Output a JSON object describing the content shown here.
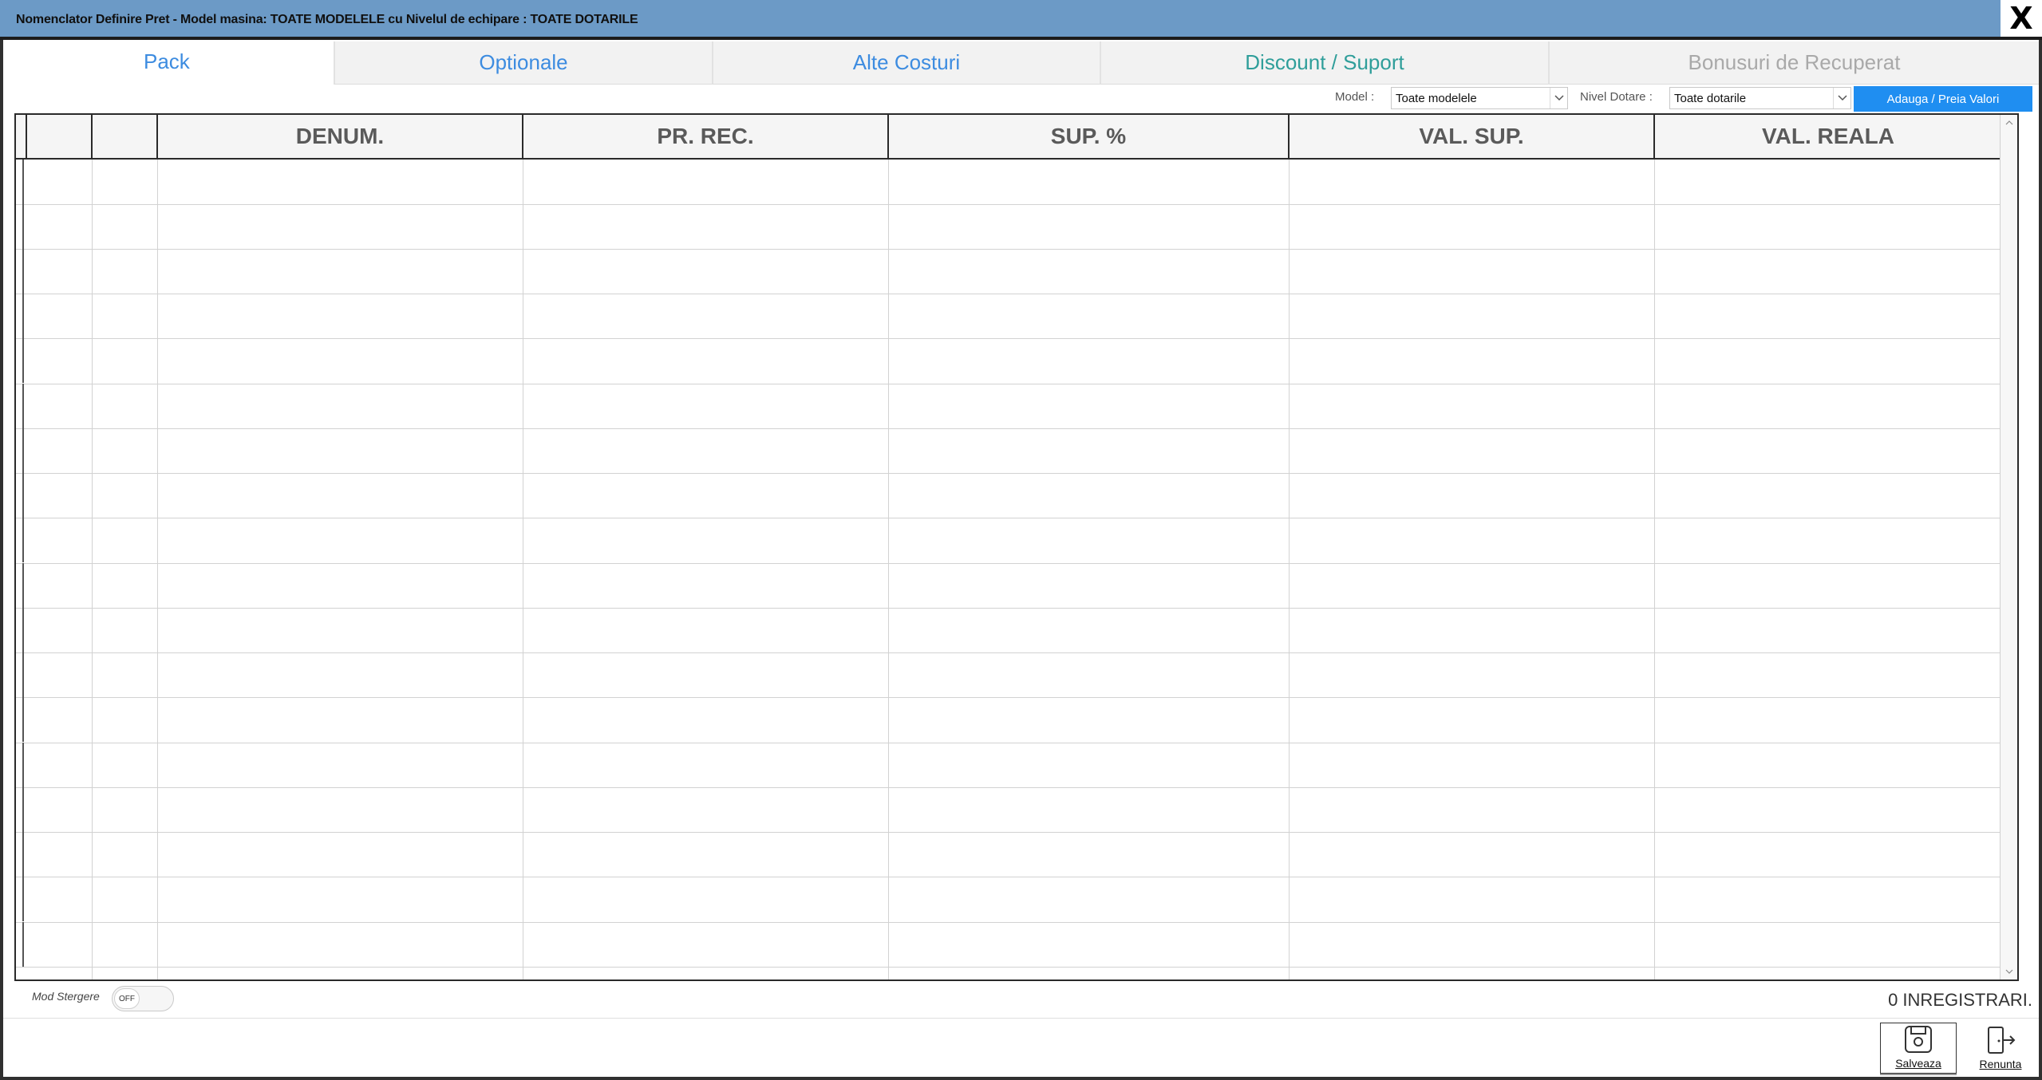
{
  "window": {
    "title": "Nomenclator Definire Pret -   Model masina: TOATE MODELELE cu Nivelul de echipare : TOATE DOTARILE",
    "close_label": "X"
  },
  "tabs": [
    {
      "label": "Pack",
      "active": true
    },
    {
      "label": "Optionale"
    },
    {
      "label": "Alte Costuri"
    },
    {
      "label": "Discount / Suport"
    },
    {
      "label": "Bonusuri de Recuperat",
      "disabled": true
    }
  ],
  "filters": {
    "model_label": "Model :",
    "model_value": "Toate modelele",
    "nivel_label": "Nivel Dotare :",
    "nivel_value": "Toate dotarile",
    "add_button": "Adauga / Preia Valori"
  },
  "grid": {
    "columns": [
      "",
      "",
      "DENUM.",
      "PR. REC.",
      "SUP. %",
      "VAL. SUP.",
      "VAL. REALA"
    ],
    "rows": []
  },
  "footer": {
    "mod_stergere_label": "Mod Stergere",
    "toggle_state": "OFF",
    "records_text": "0 INREGISTRARI.",
    "save_label": "Salveaza",
    "cancel_label": "Renunta"
  },
  "colors": {
    "titlebar": "#6c9ac6",
    "tab_text": "#3d8ce0",
    "button_blue": "#1f8ef1"
  }
}
